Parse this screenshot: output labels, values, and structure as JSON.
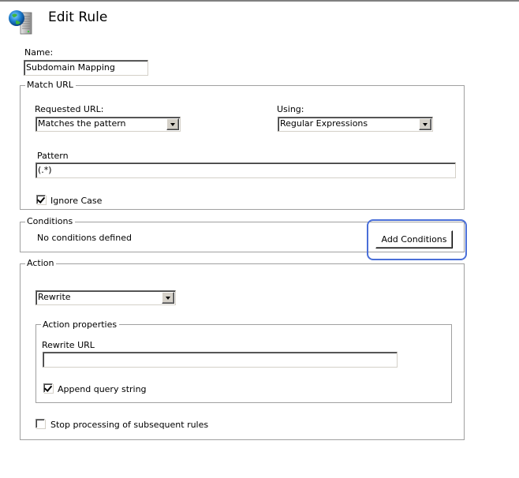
{
  "header": {
    "icon": "globe-server-icon",
    "title": "Edit Rule"
  },
  "name_field": {
    "label": "Name:",
    "value": "Subdomain Mapping"
  },
  "match_url": {
    "legend": "Match URL",
    "requested_url": {
      "label": "Requested URL:",
      "selected": "Matches the pattern"
    },
    "using": {
      "label": "Using:",
      "selected": "Regular Expressions"
    },
    "pattern": {
      "label": "Pattern",
      "value": "(.*)"
    },
    "ignore_case": {
      "label": "Ignore Case",
      "checked": true
    }
  },
  "conditions": {
    "legend": "Conditions",
    "empty_text": "No conditions defined",
    "add_button": "Add Conditions",
    "highlight_color": "#4a6fd8"
  },
  "action": {
    "legend": "Action",
    "type_selected": "Rewrite",
    "properties": {
      "legend": "Action properties",
      "rewrite_url": {
        "label": "Rewrite URL",
        "value": ""
      },
      "append_query_string": {
        "label": "Append query string",
        "checked": true
      }
    },
    "stop_processing": {
      "label": "Stop processing of subsequent rules",
      "checked": false
    }
  }
}
